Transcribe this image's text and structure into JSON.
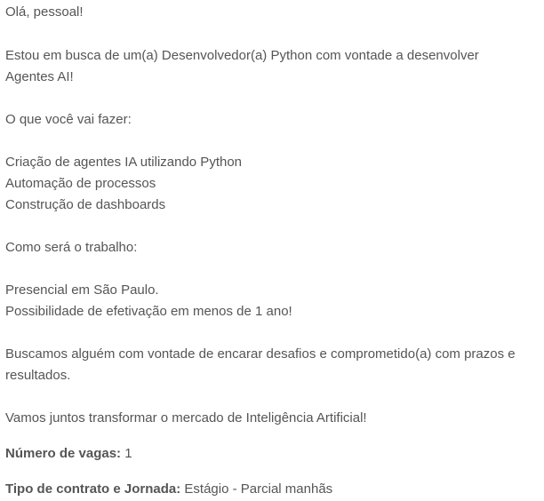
{
  "post": {
    "greeting": "Olá, pessoal!",
    "intro": "Estou em busca de um(a) Desenvolvedor(a) Python com vontade a desenvolver Agentes AI!",
    "what_heading": "O que você vai fazer:",
    "tasks": [
      "Criação de agentes IA utilizando Python",
      "Automação de processos",
      "Construção de dashboards"
    ],
    "how_heading": "Como será o trabalho:",
    "work_items": [
      "Presencial em São Paulo.",
      "Possibilidade de efetivação em menos de 1 ano!"
    ],
    "seeking": "Buscamos alguém com vontade de encarar desafios e comprometido(a) com prazos e resultados.",
    "closing": "Vamos juntos transformar o mercado de Inteligência Artificial!",
    "vacancies": {
      "label": "Número de vagas:",
      "value": "1"
    },
    "contract": {
      "label": "Tipo de contrato e Jornada:",
      "value": "Estágio - Parcial manhãs"
    }
  }
}
